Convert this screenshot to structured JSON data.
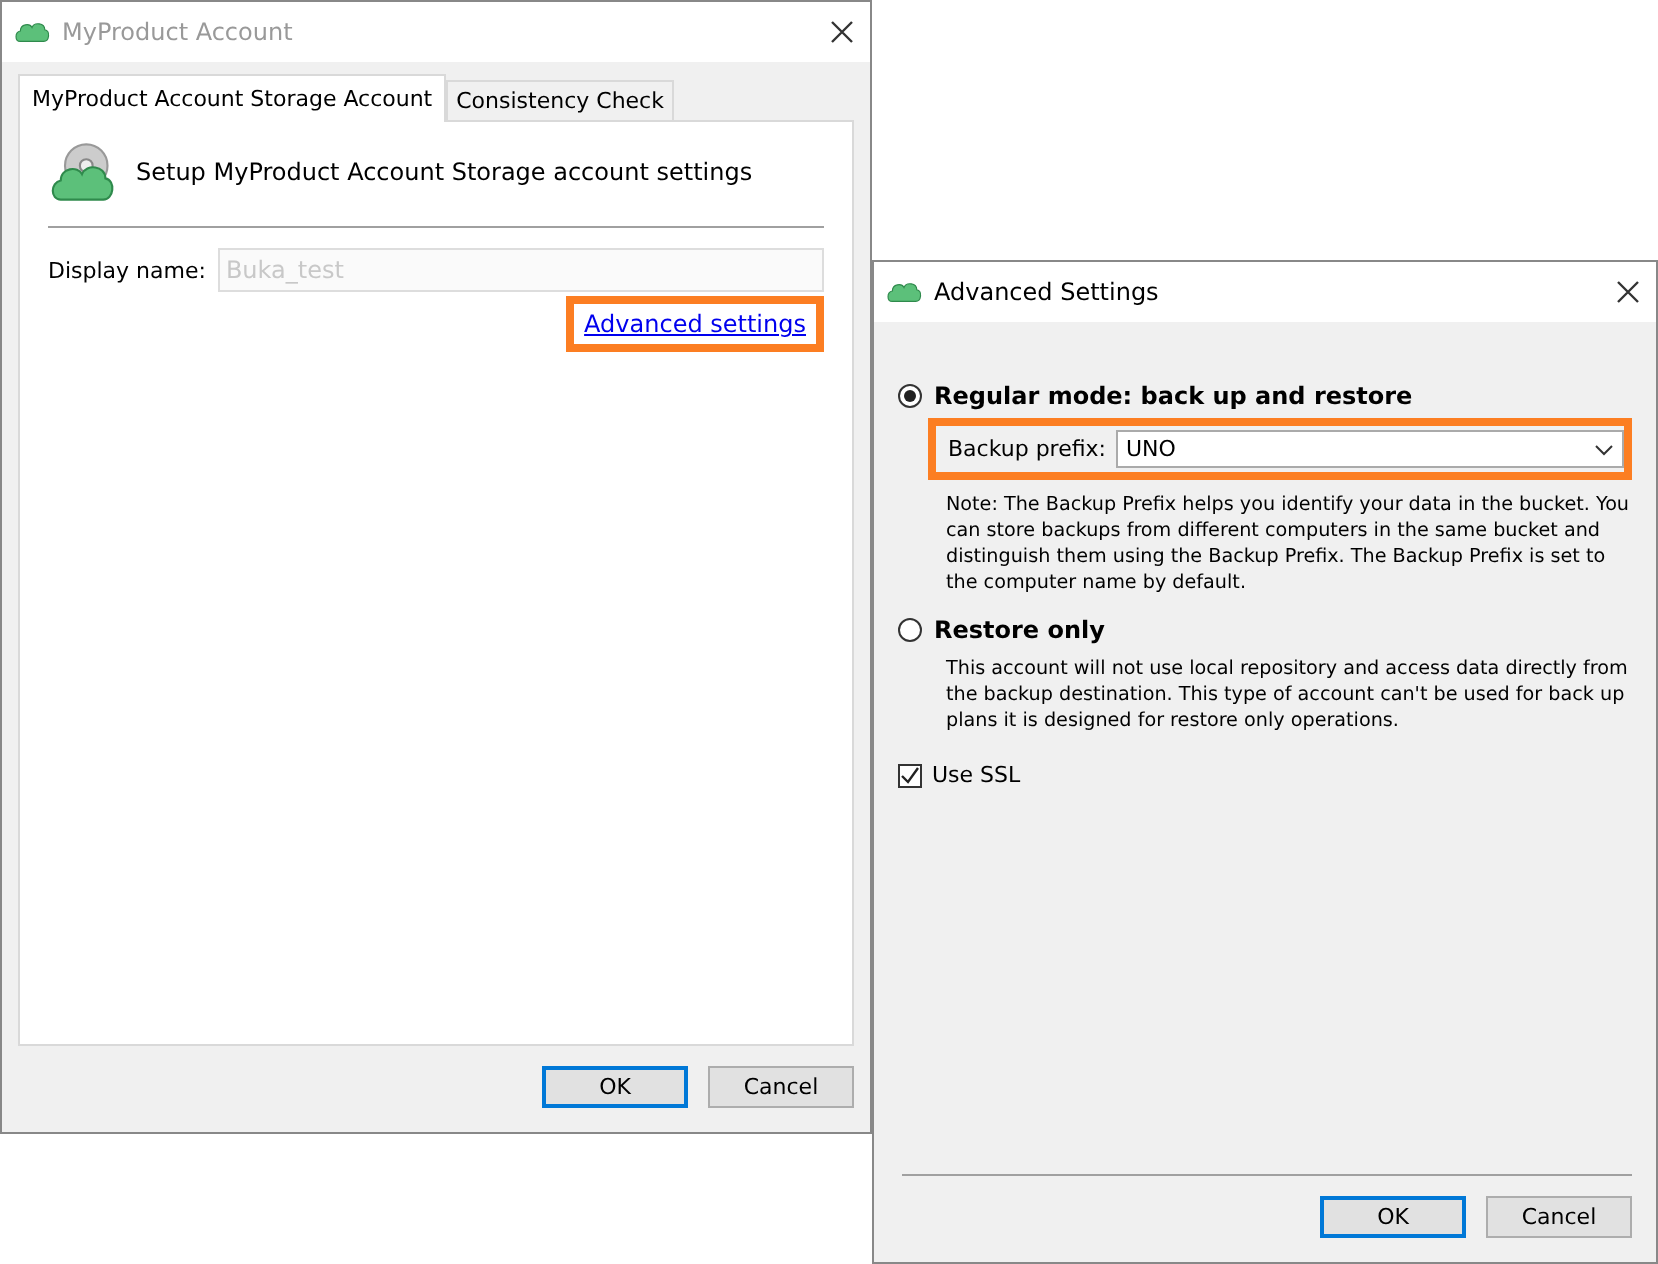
{
  "account_dialog": {
    "title": "MyProduct Account",
    "active": false,
    "tabs": [
      {
        "label": "MyProduct Account Storage Account",
        "selected": true
      },
      {
        "label": "Consistency Check",
        "selected": false
      }
    ],
    "heading": "Setup MyProduct Account Storage account settings",
    "display_name": {
      "label": "Display name:",
      "placeholder": "Buka_test",
      "disabled": true
    },
    "advanced_link": {
      "label": "Advanced settings",
      "highlighted": true
    },
    "buttons": [
      {
        "label": "OK",
        "default": true
      },
      {
        "label": "Cancel",
        "default": false
      }
    ]
  },
  "advanced_dialog": {
    "title": "Advanced Settings",
    "active": true,
    "modes": [
      {
        "label": "Regular mode: back up and restore",
        "selected": true,
        "note": "Note: The Backup Prefix helps you identify your data in the bucket. You can store backups from different computers in the same bucket and distinguish them using the Backup Prefix. The Backup Prefix is set to the computer name by default.",
        "prefix": {
          "label": "Backup prefix:",
          "value": "UNO",
          "highlighted": true
        }
      },
      {
        "label": "Restore only",
        "selected": false,
        "note": "This account will not use local repository and access data directly from the backup destination. This type of account can't be used for back up plans it is designed for restore only operations."
      }
    ],
    "use_ssl": {
      "label": "Use SSL",
      "checked": true
    },
    "buttons": [
      {
        "label": "OK",
        "default": true
      },
      {
        "label": "Cancel",
        "default": false
      }
    ]
  }
}
